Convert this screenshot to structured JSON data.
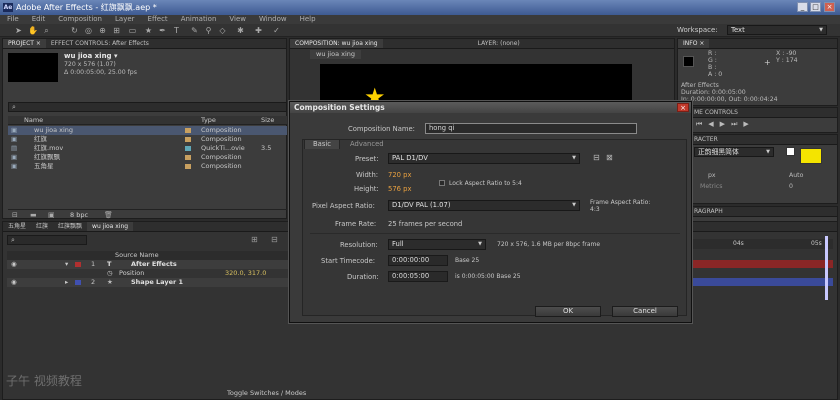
{
  "window": {
    "title": "Adobe After Effects - 红旗飘飘.aep *",
    "app_icon": "Ae"
  },
  "menu": [
    "File",
    "Edit",
    "Composition",
    "Layer",
    "Effect",
    "Animation",
    "View",
    "Window",
    "Help"
  ],
  "workspace": {
    "label": "Workspace:",
    "value": "Text"
  },
  "project_panel": {
    "tabs": [
      "PROJECT ×",
      "EFFECT CONTROLS: After Effects"
    ],
    "comp_name": "wu jioa xing ▾",
    "comp_info_1": "720 x 576 (1.07)",
    "comp_info_2": "Δ 0:00:05:00, 25.00 fps",
    "search_placeholder": "",
    "columns": [
      "Name",
      "Type",
      "Size"
    ],
    "items": [
      {
        "name": "wu jioa xing",
        "type": "Composition",
        "size": "",
        "color": "#c8a060"
      },
      {
        "name": "红旗",
        "type": "Composition",
        "size": "",
        "color": "#c8a060"
      },
      {
        "name": "红旗.mov",
        "type": "QuickTi...ovie",
        "size": "3.5",
        "color": "#60a8b8"
      },
      {
        "name": "红旗飘飘",
        "type": "Composition",
        "size": "",
        "color": "#c8a060"
      },
      {
        "name": "五角星",
        "type": "Composition",
        "size": "",
        "color": "#c8a060"
      }
    ],
    "bpc": "8 bpc"
  },
  "comp_panel": {
    "tab": "COMPOSITION: wu jioa xing",
    "tab2": "LAYER: (none)",
    "subtab": "wu jioa xing"
  },
  "info_panel": {
    "tab": "INFO ×",
    "r": "R :",
    "g": "G :",
    "b": "B :",
    "a": "A : 0",
    "x": "X : -90",
    "y": "Y : 174",
    "line1": "After Effects",
    "line2": "Duration: 0:00:05:00",
    "line3": "In: 0:00:00:00, Out: 0:00:04:24"
  },
  "right_panels": {
    "time_controls": "ME CONTROLS",
    "character": "RACTER",
    "font": "正韵细黑简体",
    "px": "px",
    "auto": "Auto",
    "metrics": "Metrics",
    "zero": "0",
    "paragraph": "RAGRAPH"
  },
  "timeline": {
    "tabs": [
      "五角星",
      "红旗",
      "红旗飘飘",
      "wu jioa xing"
    ],
    "column": "Source Name",
    "layers": [
      {
        "num": "1",
        "name": "After Effects",
        "color": "#b03030"
      },
      {
        "num": "",
        "name": "Position",
        "value": "320.0, 317.0"
      },
      {
        "num": "2",
        "name": "Shape Layer 1",
        "color": "#4050b0"
      }
    ],
    "ruler": [
      "04s",
      "05s"
    ],
    "footer": "Toggle Switches / Modes"
  },
  "dialog": {
    "title": "Composition Settings",
    "name_label": "Composition Name:",
    "name_value": "hong qi",
    "tabs": [
      "Basic",
      "Advanced"
    ],
    "preset_label": "Preset:",
    "preset_value": "PAL D1/DV",
    "width_label": "Width:",
    "width_value": "720 px",
    "height_label": "Height:",
    "height_value": "576 px",
    "lock_label": "Lock Aspect Ratio to 5:4",
    "par_label": "Pixel Aspect Ratio:",
    "par_value": "D1/DV PAL (1.07)",
    "far_label": "Frame Aspect Ratio:",
    "far_value": "4:3",
    "fr_label": "Frame Rate:",
    "fr_value": "25 frames per second",
    "res_label": "Resolution:",
    "res_value": "Full",
    "res_info": "720 x 576, 1.6 MB per 8bpc frame",
    "st_label": "Start Timecode:",
    "st_value": "0:00:00:00",
    "st_base": "Base 25",
    "dur_label": "Duration:",
    "dur_value": "0:00:05:00",
    "dur_info": "is 0:00:05:00  Base 25",
    "ok": "OK",
    "cancel": "Cancel"
  },
  "watermark": "子午 视频教程"
}
